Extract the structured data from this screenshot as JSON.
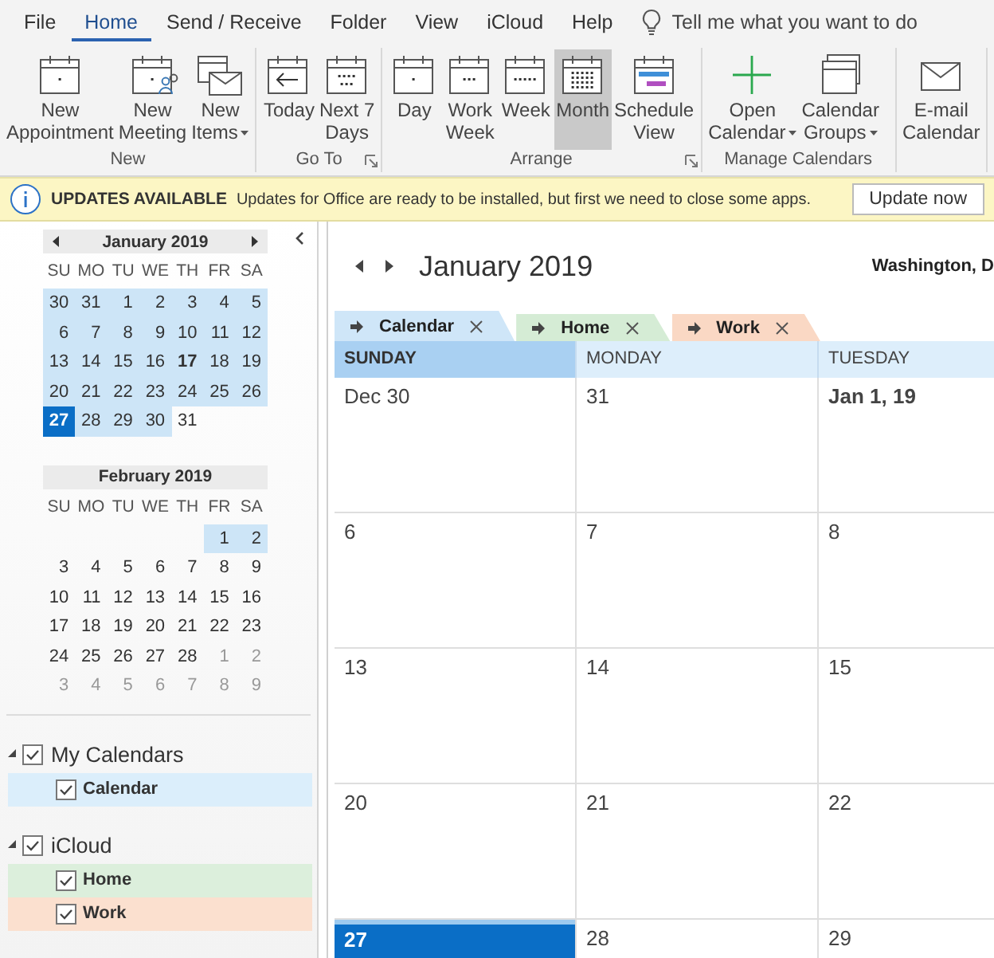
{
  "menu": {
    "tabs": [
      {
        "label": "File",
        "selected": false
      },
      {
        "label": "Home",
        "selected": true
      },
      {
        "label": "Send / Receive",
        "selected": false
      },
      {
        "label": "Folder",
        "selected": false
      },
      {
        "label": "View",
        "selected": false
      },
      {
        "label": "iCloud",
        "selected": false
      },
      {
        "label": "Help",
        "selected": false
      }
    ],
    "tell_me": {
      "placeholder": "Tell me what you want to do"
    }
  },
  "ribbon": {
    "groups": [
      {
        "label": "New",
        "launcher": false,
        "buttons": [
          {
            "lines": [
              "New",
              "Appointment"
            ],
            "dropdown": false,
            "selected": false
          },
          {
            "lines": [
              "New",
              "Meeting"
            ],
            "dropdown": false,
            "selected": false
          },
          {
            "lines": [
              "New",
              "Items"
            ],
            "dropdown": true,
            "selected": false
          }
        ]
      },
      {
        "label": "Go To",
        "launcher": true,
        "buttons": [
          {
            "lines": [
              "Today"
            ],
            "dropdown": false,
            "selected": false
          },
          {
            "lines": [
              "Next 7",
              "Days"
            ],
            "dropdown": false,
            "selected": false
          }
        ]
      },
      {
        "label": "Arrange",
        "launcher": true,
        "buttons": [
          {
            "lines": [
              "Day"
            ],
            "dropdown": false,
            "selected": false
          },
          {
            "lines": [
              "Work",
              "Week"
            ],
            "dropdown": false,
            "selected": false
          },
          {
            "lines": [
              "Week"
            ],
            "dropdown": false,
            "selected": false
          },
          {
            "lines": [
              "Month"
            ],
            "dropdown": false,
            "selected": true
          },
          {
            "lines": [
              "Schedule",
              "View"
            ],
            "dropdown": false,
            "selected": false
          }
        ]
      },
      {
        "label": "Manage Calendars",
        "launcher": false,
        "buttons": [
          {
            "lines": [
              "Open",
              "Calendar"
            ],
            "dropdown": true,
            "selected": false
          },
          {
            "lines": [
              "Calendar",
              "Groups"
            ],
            "dropdown": true,
            "selected": false
          }
        ]
      },
      {
        "launcher": false,
        "buttons": [
          {
            "lines": [
              "E-mail",
              "Calendar"
            ],
            "dropdown": false,
            "selected": false
          }
        ]
      }
    ]
  },
  "update_bar": {
    "title": "UPDATES AVAILABLE",
    "message": "Updates for Office are ready to be installed, but first we need to close some apps.",
    "button": "Update now"
  },
  "navigator": {
    "mini_calendars": [
      {
        "title": "January 2019",
        "nav": true,
        "weekdays": [
          "SU",
          "MO",
          "TU",
          "WE",
          "TH",
          "FR",
          "SA"
        ],
        "weeks": [
          [
            {
              "d": "30",
              "selected": true,
              "today": false,
              "bold": false,
              "dim": false
            },
            {
              "d": "31",
              "selected": true,
              "today": false,
              "bold": false,
              "dim": false
            },
            {
              "d": "1",
              "selected": true,
              "today": false,
              "bold": false,
              "dim": false
            },
            {
              "d": "2",
              "selected": true,
              "today": false,
              "bold": false,
              "dim": false
            },
            {
              "d": "3",
              "selected": true,
              "today": false,
              "bold": false,
              "dim": false
            },
            {
              "d": "4",
              "selected": true,
              "today": false,
              "bold": false,
              "dim": false
            },
            {
              "d": "5",
              "selected": true,
              "today": false,
              "bold": false,
              "dim": false
            }
          ],
          [
            {
              "d": "6",
              "selected": true,
              "today": false,
              "bold": false,
              "dim": false
            },
            {
              "d": "7",
              "selected": true,
              "today": false,
              "bold": false,
              "dim": false
            },
            {
              "d": "8",
              "selected": true,
              "today": false,
              "bold": false,
              "dim": false
            },
            {
              "d": "9",
              "selected": true,
              "today": false,
              "bold": false,
              "dim": false
            },
            {
              "d": "10",
              "selected": true,
              "today": false,
              "bold": false,
              "dim": false
            },
            {
              "d": "11",
              "selected": true,
              "today": false,
              "bold": false,
              "dim": false
            },
            {
              "d": "12",
              "selected": true,
              "today": false,
              "bold": false,
              "dim": false
            }
          ],
          [
            {
              "d": "13",
              "selected": true,
              "today": false,
              "bold": false,
              "dim": false
            },
            {
              "d": "14",
              "selected": true,
              "today": false,
              "bold": false,
              "dim": false
            },
            {
              "d": "15",
              "selected": true,
              "today": false,
              "bold": false,
              "dim": false
            },
            {
              "d": "16",
              "selected": true,
              "today": false,
              "bold": false,
              "dim": false
            },
            {
              "d": "17",
              "selected": true,
              "today": false,
              "bold": true,
              "dim": false
            },
            {
              "d": "18",
              "selected": true,
              "today": false,
              "bold": false,
              "dim": false
            },
            {
              "d": "19",
              "selected": true,
              "today": false,
              "bold": false,
              "dim": false
            }
          ],
          [
            {
              "d": "20",
              "selected": true,
              "today": false,
              "bold": false,
              "dim": false
            },
            {
              "d": "21",
              "selected": true,
              "today": false,
              "bold": false,
              "dim": false
            },
            {
              "d": "22",
              "selected": true,
              "today": false,
              "bold": false,
              "dim": false
            },
            {
              "d": "23",
              "selected": true,
              "today": false,
              "bold": false,
              "dim": false
            },
            {
              "d": "24",
              "selected": true,
              "today": false,
              "bold": false,
              "dim": false
            },
            {
              "d": "25",
              "selected": true,
              "today": false,
              "bold": false,
              "dim": false
            },
            {
              "d": "26",
              "selected": true,
              "today": false,
              "bold": false,
              "dim": false
            }
          ],
          [
            {
              "d": "27",
              "selected": true,
              "today": true,
              "bold": true,
              "dim": false
            },
            {
              "d": "28",
              "selected": true,
              "today": false,
              "bold": false,
              "dim": false
            },
            {
              "d": "29",
              "selected": true,
              "today": false,
              "bold": false,
              "dim": false
            },
            {
              "d": "30",
              "selected": true,
              "today": false,
              "bold": false,
              "dim": false
            },
            {
              "d": "31",
              "selected": false,
              "today": false,
              "bold": false,
              "dim": false
            }
          ]
        ]
      },
      {
        "title": "February 2019",
        "nav": false,
        "weekdays": [
          "SU",
          "MO",
          "TU",
          "WE",
          "TH",
          "FR",
          "SA"
        ],
        "weeks": [
          [
            {
              "d": "1",
              "selected": true,
              "today": false,
              "bold": false,
              "dim": false
            },
            {
              "d": "2",
              "selected": true,
              "today": false,
              "bold": false,
              "dim": false
            }
          ],
          [
            {
              "d": "3",
              "selected": false,
              "today": false,
              "bold": false,
              "dim": false
            },
            {
              "d": "4",
              "selected": false,
              "today": false,
              "bold": false,
              "dim": false
            },
            {
              "d": "5",
              "selected": false,
              "today": false,
              "bold": false,
              "dim": false
            },
            {
              "d": "6",
              "selected": false,
              "today": false,
              "bold": false,
              "dim": false
            },
            {
              "d": "7",
              "selected": false,
              "today": false,
              "bold": false,
              "dim": false
            },
            {
              "d": "8",
              "selected": false,
              "today": false,
              "bold": false,
              "dim": false
            },
            {
              "d": "9",
              "selected": false,
              "today": false,
              "bold": false,
              "dim": false
            }
          ],
          [
            {
              "d": "10",
              "selected": false,
              "today": false,
              "bold": false,
              "dim": false
            },
            {
              "d": "11",
              "selected": false,
              "today": false,
              "bold": false,
              "dim": false
            },
            {
              "d": "12",
              "selected": false,
              "today": false,
              "bold": false,
              "dim": false
            },
            {
              "d": "13",
              "selected": false,
              "today": false,
              "bold": false,
              "dim": false
            },
            {
              "d": "14",
              "selected": false,
              "today": false,
              "bold": false,
              "dim": false
            },
            {
              "d": "15",
              "selected": false,
              "today": false,
              "bold": false,
              "dim": false
            },
            {
              "d": "16",
              "selected": false,
              "today": false,
              "bold": false,
              "dim": false
            }
          ],
          [
            {
              "d": "17",
              "selected": false,
              "today": false,
              "bold": false,
              "dim": false
            },
            {
              "d": "18",
              "selected": false,
              "today": false,
              "bold": false,
              "dim": false
            },
            {
              "d": "19",
              "selected": false,
              "today": false,
              "bold": false,
              "dim": false
            },
            {
              "d": "20",
              "selected": false,
              "today": false,
              "bold": false,
              "dim": false
            },
            {
              "d": "21",
              "selected": false,
              "today": false,
              "bold": false,
              "dim": false
            },
            {
              "d": "22",
              "selected": false,
              "today": false,
              "bold": false,
              "dim": false
            },
            {
              "d": "23",
              "selected": false,
              "today": false,
              "bold": false,
              "dim": false
            }
          ],
          [
            {
              "d": "24",
              "selected": false,
              "today": false,
              "bold": false,
              "dim": false
            },
            {
              "d": "25",
              "selected": false,
              "today": false,
              "bold": false,
              "dim": false
            },
            {
              "d": "26",
              "selected": false,
              "today": false,
              "bold": false,
              "dim": false
            },
            {
              "d": "27",
              "selected": false,
              "today": false,
              "bold": false,
              "dim": false
            },
            {
              "d": "28",
              "selected": false,
              "today": false,
              "bold": false,
              "dim": false
            },
            {
              "d": "1",
              "selected": false,
              "today": false,
              "bold": false,
              "dim": true
            },
            {
              "d": "2",
              "selected": false,
              "today": false,
              "bold": false,
              "dim": true
            }
          ],
          [
            {
              "d": "3",
              "selected": false,
              "today": false,
              "bold": false,
              "dim": true
            },
            {
              "d": "4",
              "selected": false,
              "today": false,
              "bold": false,
              "dim": true
            },
            {
              "d": "5",
              "selected": false,
              "today": false,
              "bold": false,
              "dim": true
            },
            {
              "d": "6",
              "selected": false,
              "today": false,
              "bold": false,
              "dim": true
            },
            {
              "d": "7",
              "selected": false,
              "today": false,
              "bold": false,
              "dim": true
            },
            {
              "d": "8",
              "selected": false,
              "today": false,
              "bold": false,
              "dim": true
            },
            {
              "d": "9",
              "selected": false,
              "today": false,
              "bold": false,
              "dim": true
            }
          ]
        ]
      }
    ],
    "folders": [
      {
        "label": "My Calendars",
        "expanded": true,
        "checked": true,
        "children": [
          {
            "label": "Calendar",
            "checked": true,
            "color": "#dbeefb"
          }
        ]
      },
      {
        "label": "iCloud",
        "expanded": true,
        "checked": true,
        "children": [
          {
            "label": "Home",
            "checked": true,
            "color": "#dcefdc"
          },
          {
            "label": "Work",
            "checked": true,
            "color": "#fbe0cf"
          }
        ]
      }
    ]
  },
  "calendar": {
    "title": "January 2019",
    "location": "Washington, D",
    "tabs": [
      {
        "label": "Calendar",
        "color": "#cfe6f8",
        "selected": true
      },
      {
        "label": "Home",
        "color": "#d5ecd5",
        "selected": false
      },
      {
        "label": "Work",
        "color": "#fad8c4",
        "selected": false
      }
    ],
    "day_headers": [
      {
        "label": "SUNDAY",
        "selected": true
      },
      {
        "label": "MONDAY",
        "selected": false
      },
      {
        "label": "TUESDAY",
        "selected": false
      }
    ],
    "weeks": [
      [
        {
          "label": "Dec 30",
          "bold": false,
          "today": false
        },
        {
          "label": "31",
          "bold": false,
          "today": false
        },
        {
          "label": "Jan 1, 19",
          "bold": true,
          "today": false
        }
      ],
      [
        {
          "label": "6",
          "bold": false,
          "today": false
        },
        {
          "label": "7",
          "bold": false,
          "today": false
        },
        {
          "label": "8",
          "bold": false,
          "today": false
        }
      ],
      [
        {
          "label": "13",
          "bold": false,
          "today": false
        },
        {
          "label": "14",
          "bold": false,
          "today": false
        },
        {
          "label": "15",
          "bold": false,
          "today": false
        }
      ],
      [
        {
          "label": "20",
          "bold": false,
          "today": false
        },
        {
          "label": "21",
          "bold": false,
          "today": false
        },
        {
          "label": "22",
          "bold": false,
          "today": false
        }
      ],
      [
        {
          "label": "27",
          "bold": true,
          "today": true
        },
        {
          "label": "28",
          "bold": false,
          "today": false
        },
        {
          "label": "29",
          "bold": false,
          "today": false
        }
      ]
    ]
  }
}
